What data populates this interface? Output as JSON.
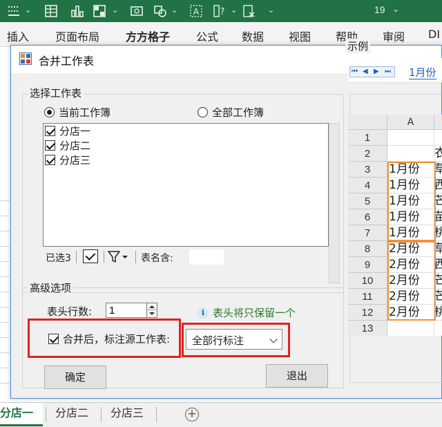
{
  "excel": {
    "quick_access_number": "19",
    "ribbon_tabs": [
      "插入",
      "页面布局",
      "方方格子",
      "公式",
      "数据",
      "视图",
      "帮助",
      "审阅",
      "DI"
    ],
    "sheet_tabs": [
      "分店一",
      "分店二",
      "分店三"
    ],
    "add_sheet_symbol": "+",
    "accent_color": "#217346"
  },
  "dialog": {
    "title": "合并工作表",
    "select_group": {
      "label": "选择工作表",
      "radio_current": "当前工作簿",
      "radio_all": "全部工作簿",
      "radio_selected": "current",
      "sheets": [
        {
          "name": "分店一",
          "checked": true
        },
        {
          "name": "分店二",
          "checked": true
        },
        {
          "name": "分店三",
          "checked": true
        }
      ],
      "selected_count": "已选3",
      "name_contains_label": "表名含:",
      "name_contains_value": ""
    },
    "advanced_group": {
      "label": "高级选项",
      "header_rows_label": "表头行数:",
      "header_rows_value": "1",
      "info_text": "表头将只保留一个",
      "mark_source_label": "合并后，标注源工作表:",
      "mark_source_checked": true,
      "mark_mode_value": "全部行标注"
    },
    "ok_button": "确定",
    "exit_button": "退出",
    "highlight_color": "#e0231f"
  },
  "example": {
    "label": "示例",
    "tab_name": "1月份",
    "column_header": "A",
    "rows": [
      {
        "num": "1",
        "a": "",
        "b": ""
      },
      {
        "num": "2",
        "a": "",
        "b": "衣"
      },
      {
        "num": "3",
        "a": "1月份",
        "b": "草"
      },
      {
        "num": "4",
        "a": "1月份",
        "b": "西"
      },
      {
        "num": "5",
        "a": "1月份",
        "b": "芒"
      },
      {
        "num": "6",
        "a": "1月份",
        "b": "苗"
      },
      {
        "num": "7",
        "a": "1月份",
        "b": "桃"
      },
      {
        "num": "8",
        "a": "2月份",
        "b": "草"
      },
      {
        "num": "9",
        "a": "2月份",
        "b": "西"
      },
      {
        "num": "10",
        "a": "2月份",
        "b": "芒"
      },
      {
        "num": "11",
        "a": "2月份",
        "b": "芒"
      },
      {
        "num": "12",
        "a": "2月份",
        "b": "桃"
      },
      {
        "num": "13",
        "a": "",
        "b": ""
      }
    ],
    "group_box_color": "#f0913a"
  }
}
